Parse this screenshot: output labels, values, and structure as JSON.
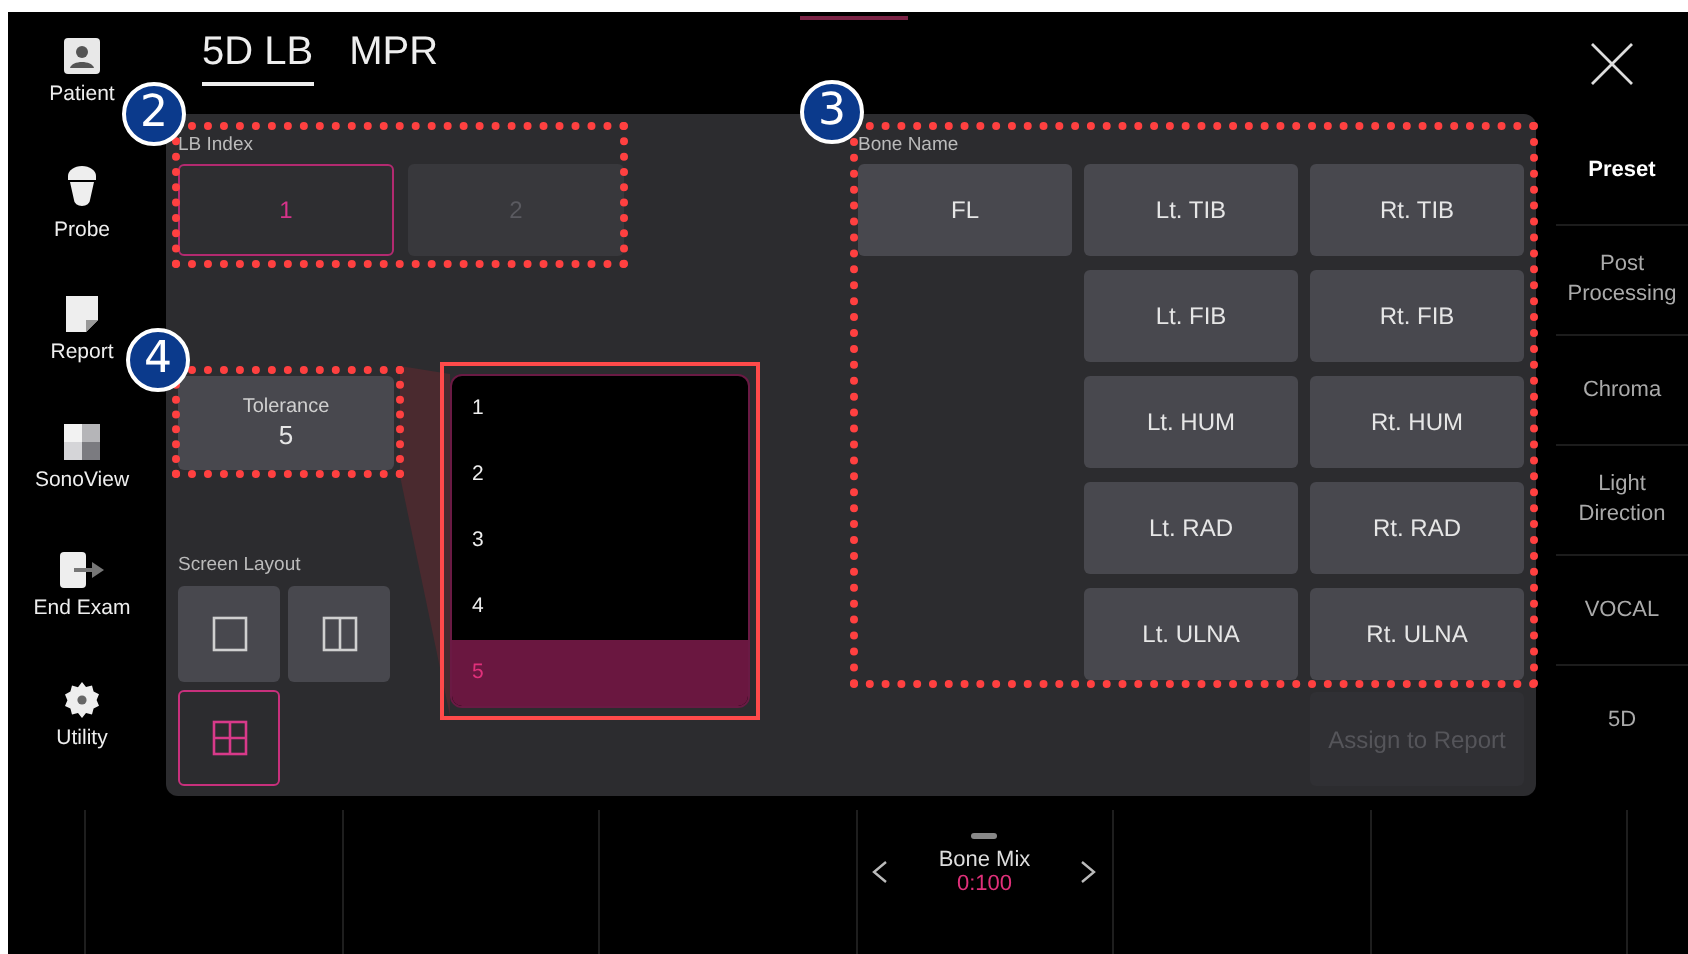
{
  "sidebar": {
    "items": [
      {
        "label": "Patient",
        "kind": "patient"
      },
      {
        "label": "Probe",
        "kind": "probe"
      },
      {
        "label": "Report",
        "kind": "report"
      },
      {
        "label": "SonoView",
        "kind": "sonoview"
      },
      {
        "label": "End Exam",
        "kind": "endexam"
      },
      {
        "label": "Utility",
        "kind": "utility"
      }
    ]
  },
  "tabs": [
    {
      "label": "5D LB",
      "selected": true
    },
    {
      "label": "MPR",
      "selected": false
    }
  ],
  "lb_index": {
    "label": "LB Index",
    "buttons": [
      {
        "label": "1",
        "selected": true,
        "disabled": false
      },
      {
        "label": "2",
        "selected": false,
        "disabled": true
      }
    ]
  },
  "tolerance": {
    "label": "Tolerance",
    "value": "5",
    "options": [
      {
        "label": "1",
        "selected": false
      },
      {
        "label": "2",
        "selected": false
      },
      {
        "label": "3",
        "selected": false
      },
      {
        "label": "4",
        "selected": false
      },
      {
        "label": "5",
        "selected": true
      }
    ]
  },
  "screen_layout": {
    "label": "Screen Layout",
    "options": [
      {
        "kind": "single",
        "selected": false
      },
      {
        "kind": "split",
        "selected": false
      },
      {
        "kind": "quad",
        "selected": true
      }
    ]
  },
  "bone_name": {
    "label": "Bone Name",
    "columns": [
      [
        "FL"
      ],
      [
        "Lt. TIB",
        "Lt. FIB",
        "Lt. HUM",
        "Lt. RAD",
        "Lt. ULNA"
      ],
      [
        "Rt. TIB",
        "Rt. FIB",
        "Rt. HUM",
        "Rt. RAD",
        "Rt. ULNA"
      ]
    ]
  },
  "assign_button": {
    "label": "Assign to Report",
    "disabled": true
  },
  "right_menu": {
    "items": [
      {
        "label": "Preset",
        "selected": true
      },
      {
        "label": "Post Processing",
        "selected": false
      },
      {
        "label": "Chroma",
        "selected": false
      },
      {
        "label": "Light Direction",
        "selected": false
      },
      {
        "label": "VOCAL",
        "selected": false
      },
      {
        "label": "5D",
        "selected": false
      }
    ]
  },
  "bottom_bar": {
    "knob": {
      "label": "Bone Mix",
      "value": "0:100"
    }
  },
  "annotations": [
    {
      "label": "2"
    },
    {
      "label": "3"
    },
    {
      "label": "4"
    }
  ]
}
